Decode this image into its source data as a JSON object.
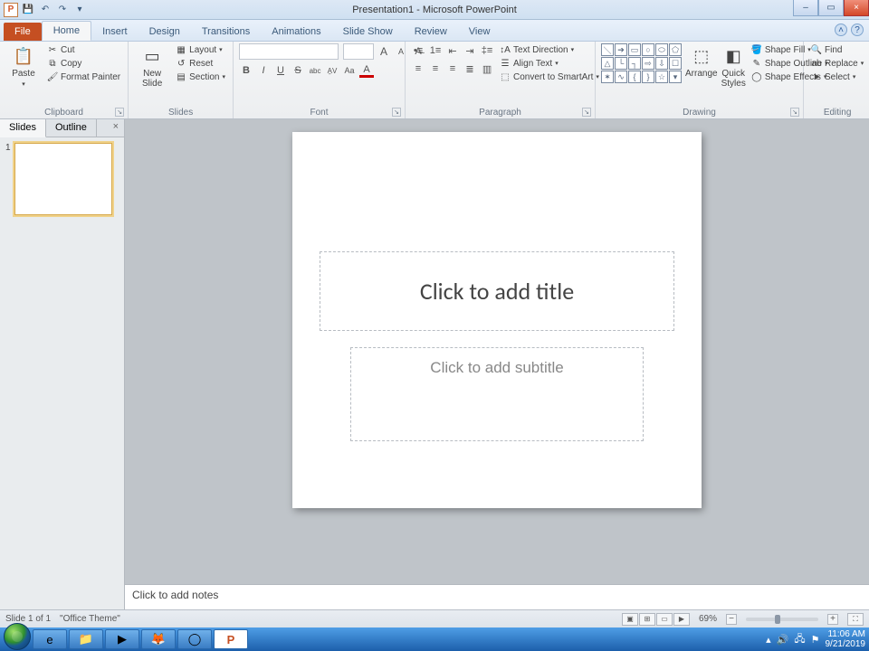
{
  "titlebar": {
    "title": "Presentation1 - Microsoft PowerPoint",
    "app_letter": "P"
  },
  "window_controls": {
    "min": "–",
    "max": "▭",
    "close": "×"
  },
  "tabs": {
    "file": "File",
    "items": [
      "Home",
      "Insert",
      "Design",
      "Transitions",
      "Animations",
      "Slide Show",
      "Review",
      "View"
    ],
    "active": "Home"
  },
  "ribbon": {
    "clipboard": {
      "label": "Clipboard",
      "paste": "Paste",
      "cut": "Cut",
      "copy": "Copy",
      "format_painter": "Format Painter"
    },
    "slides": {
      "label": "Slides",
      "new_slide": "New\nSlide",
      "layout": "Layout",
      "reset": "Reset",
      "section": "Section"
    },
    "font": {
      "label": "Font",
      "bold": "B",
      "italic": "I",
      "underline": "U",
      "strike": "S",
      "shadow": "abc",
      "spacing": "AV",
      "case": "Aa",
      "color": "A",
      "grow": "A",
      "shrink": "A",
      "clear": "⌫"
    },
    "paragraph": {
      "label": "Paragraph",
      "text_direction": "Text Direction",
      "align_text": "Align Text",
      "convert_smartart": "Convert to SmartArt"
    },
    "drawing": {
      "label": "Drawing",
      "arrange": "Arrange",
      "quick_styles": "Quick\nStyles",
      "shape_fill": "Shape Fill",
      "shape_outline": "Shape Outline",
      "shape_effects": "Shape Effects"
    },
    "editing": {
      "label": "Editing",
      "find": "Find",
      "replace": "Replace",
      "select": "Select"
    }
  },
  "sidepanel": {
    "tabs": {
      "slides": "Slides",
      "outline": "Outline"
    },
    "close": "×",
    "thumbs": [
      {
        "num": "1"
      }
    ]
  },
  "slide": {
    "title_placeholder": "Click to add title",
    "subtitle_placeholder": "Click to add subtitle"
  },
  "notes": {
    "placeholder": "Click to add notes"
  },
  "statusbar": {
    "slide_info": "Slide 1 of 1",
    "theme": "\"Office Theme\"",
    "zoom": "69%"
  },
  "taskbar": {
    "time": "11:06 AM",
    "date": "9/21/2019"
  }
}
